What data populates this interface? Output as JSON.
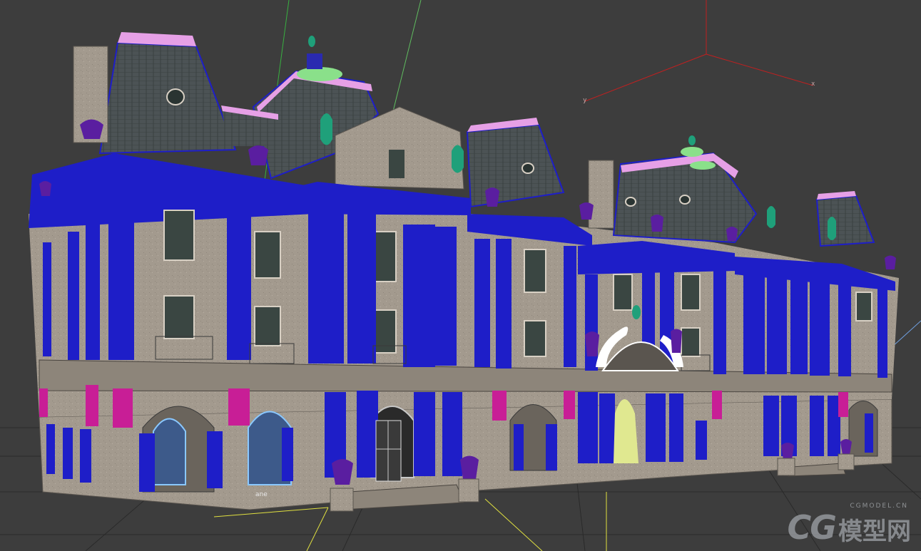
{
  "viewport": {
    "gizmo": {
      "x_label": "x",
      "y_label": "y"
    },
    "selected_object_label": "ane",
    "watermark": {
      "logo": "CG",
      "cn_text": "模型网",
      "domain": "CGMODEL.CN"
    }
  },
  "colors": {
    "background": "#3d3d3d",
    "grid": "#2a2a2a",
    "facade": "#a39a8e",
    "columns": "#1e1ec8",
    "roof": "#4a5052",
    "roof_crest": "#e6a0e6",
    "finial": "#1fa07a",
    "urn": "#5a1ea0",
    "magenta": "#c81e96",
    "window": "#3a4642"
  }
}
